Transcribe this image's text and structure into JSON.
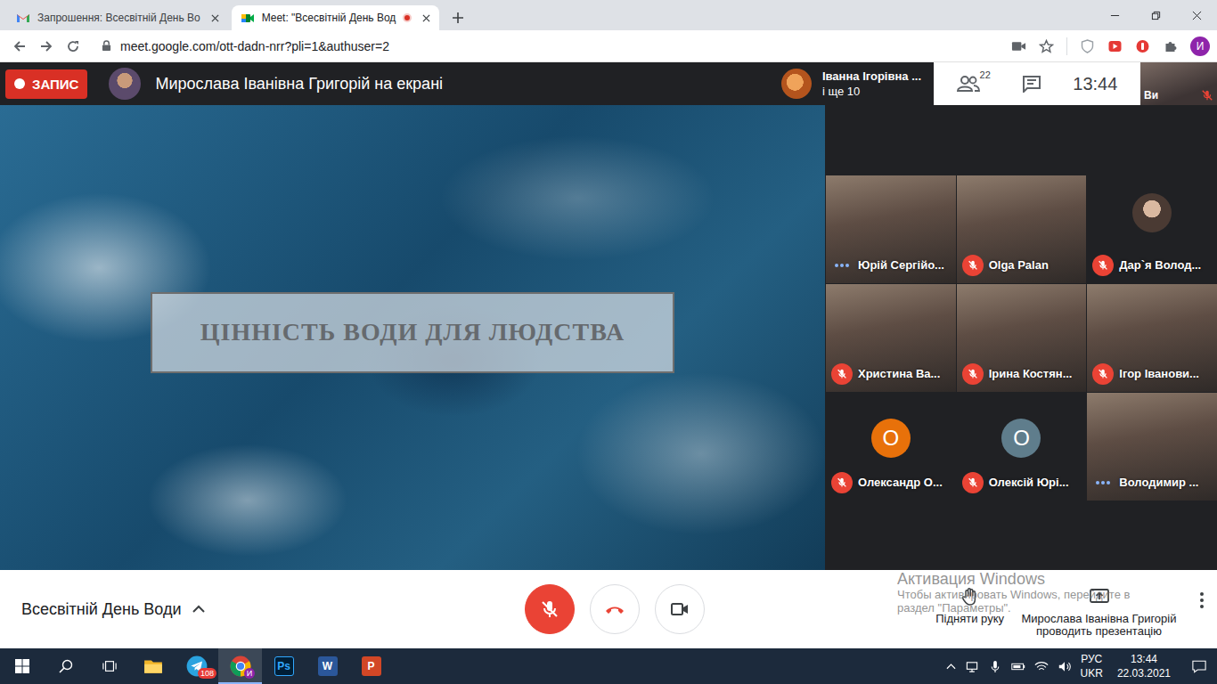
{
  "browser": {
    "tabs": [
      {
        "kind": "gmail",
        "title": "Запрошення: Всесвітній День Во",
        "selected": false,
        "recording": false
      },
      {
        "kind": "meet",
        "title": "Meet: \"Всесвітній День Вод",
        "selected": true,
        "recording": true
      }
    ],
    "url": "meet.google.com/ott-dadn-nrr?pli=1&authuser=2",
    "profile_initial": "И"
  },
  "meet": {
    "recording_label": "ЗАПИС",
    "presenter_banner": "Мирослава Іванівна Григорій на екрані",
    "speaker": {
      "name": "Іванна Ігорівна ...",
      "more": "і ще 10"
    },
    "participants_count": "22",
    "clock": "13:44",
    "self": {
      "label": "Ви",
      "muted": true
    },
    "slide_title": "ЦІННІСТЬ ВОДИ ДЛЯ ЛЮДСТВА",
    "tiles": [
      {
        "kind": "video",
        "name": "Юрій Сергійо...",
        "muted": false
      },
      {
        "kind": "video",
        "name": "Olga Palan",
        "muted": true
      },
      {
        "kind": "photo",
        "name": "Дар`я Волод...",
        "muted": true
      },
      {
        "kind": "video",
        "name": "Христина Ва...",
        "muted": true
      },
      {
        "kind": "video",
        "name": "Ірина Костян...",
        "muted": true
      },
      {
        "kind": "video",
        "name": "Ігор Іванови...",
        "muted": true
      },
      {
        "kind": "letter",
        "name": "Олександр О...",
        "muted": true,
        "letter": "О",
        "color": "#e8710a"
      },
      {
        "kind": "letter",
        "name": "Олексій Юрі...",
        "muted": true,
        "letter": "О",
        "color": "#5f7d8c"
      },
      {
        "kind": "video",
        "name": "Володимир ...",
        "muted": false
      }
    ],
    "meeting_title": "Всесвітній День Води",
    "controls": [
      {
        "kind": "mic",
        "on": false
      },
      {
        "kind": "hangup",
        "on": true
      },
      {
        "kind": "camera",
        "on": true
      }
    ],
    "raise_hand": "Підняти руку",
    "presenting_note": "Мирослава Іванівна Григорій проводить презентацію"
  },
  "watermark": {
    "title": "Активация Windows",
    "lines": [
      "Чтобы активировать Windows, перейдите в",
      "раздел \"Параметры\"."
    ]
  },
  "taskbar": {
    "apps": [
      {
        "kind": "start",
        "selected": false
      },
      {
        "kind": "search",
        "selected": false
      },
      {
        "kind": "taskview",
        "selected": false
      },
      {
        "kind": "explorer",
        "selected": false
      },
      {
        "kind": "telegram",
        "selected": false,
        "badge": "108"
      },
      {
        "kind": "chrome",
        "selected": true,
        "badge": "И"
      },
      {
        "kind": "photoshop",
        "selected": false,
        "label": "Ps"
      },
      {
        "kind": "word",
        "selected": false,
        "label": "W"
      },
      {
        "kind": "powerpoint",
        "selected": false,
        "label": "P"
      }
    ],
    "language": "РУС",
    "layout": "UKR",
    "time": "13:44",
    "date": "22.03.2021"
  }
}
